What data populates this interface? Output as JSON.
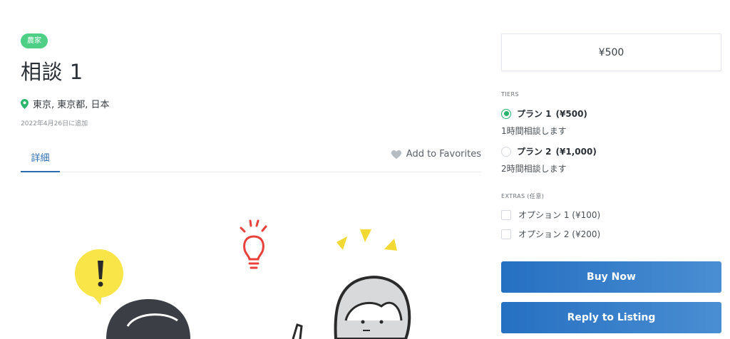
{
  "listing": {
    "category_badge": "農家",
    "title": "相談 1",
    "location": "東京, 東京都, 日本",
    "added_date": "2022年4月26日に追加"
  },
  "tabs": {
    "detail_label": "詳細",
    "favorites_label": "Add to Favorites"
  },
  "sidebar": {
    "price": "¥500",
    "tiers_heading": "TIERS",
    "tiers": [
      {
        "name": "プラン 1",
        "price": "(¥500)",
        "description": "1時間相談します",
        "selected": true
      },
      {
        "name": "プラン 2",
        "price": "(¥1,000)",
        "description": "2時間相談します",
        "selected": false
      }
    ],
    "extras_heading": "EXTRAS (任意)",
    "extras": [
      {
        "label": "オプション 1 (¥100)",
        "checked": false
      },
      {
        "label": "オプション 2 (¥200)",
        "checked": false
      }
    ],
    "buy_label": "Buy Now",
    "reply_label": "Reply to Listing"
  },
  "colors": {
    "badge": "#4ecf86",
    "accent": "#2b6cb0",
    "radio_selected": "#28b46a",
    "button_start": "#2670c2",
    "button_end": "#4a8ed2"
  },
  "icons": {
    "location": "map-pin-icon",
    "favorites": "heart-icon"
  }
}
